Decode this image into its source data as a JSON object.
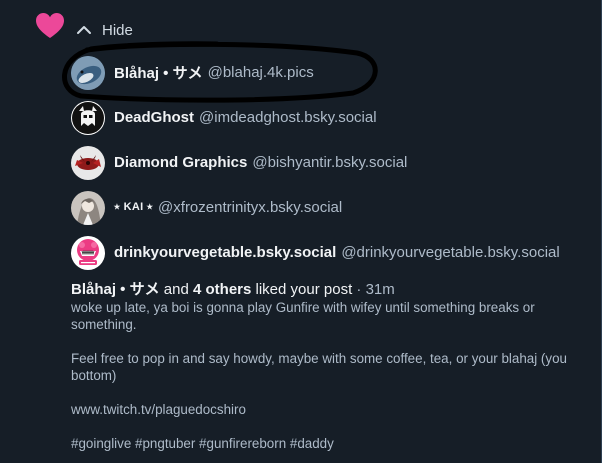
{
  "header": {
    "heart_color": "#ec4899",
    "hide_label": "Hide"
  },
  "likers": [
    {
      "name": "Blåhaj • サメ",
      "handle": "@blahaj.4k.pics",
      "avatar": "blue-shark-photo"
    },
    {
      "name": "DeadGhost",
      "handle": "@imdeadghost.bsky.social",
      "avatar": "ghost-face"
    },
    {
      "name": "Diamond Graphics",
      "handle": "@bishyantir.bsky.social",
      "avatar": "red-creature"
    },
    {
      "name": "⭑ KAI ⭑",
      "handle": "@xfrozentrinityx.bsky.social",
      "avatar": "anime-character"
    },
    {
      "name": "drinkyourvegetable.bsky.social",
      "handle": "@drinkyourvegetable.bsky.social",
      "avatar": "pink-creature"
    }
  ],
  "summary": {
    "first_name": "Blåhaj • サメ",
    "and": "and",
    "others": "4 others",
    "action": "liked your post",
    "separator": "·",
    "time": "31m"
  },
  "post": {
    "line1": "woke up late, ya boi is gonna play Gunfire with wifey until something breaks or something.",
    "line2": "Feel free to pop in and say howdy, maybe with some coffee, tea, or your blahaj (you bottom)",
    "line3": "www.twitch.tv/plaguedocshiro",
    "line4": "#goinglive #pngtuber #gunfirereborn #daddy"
  },
  "colors": {
    "background": "#161e27",
    "muted_text": "#aebbc9",
    "annotation": "#000000"
  }
}
